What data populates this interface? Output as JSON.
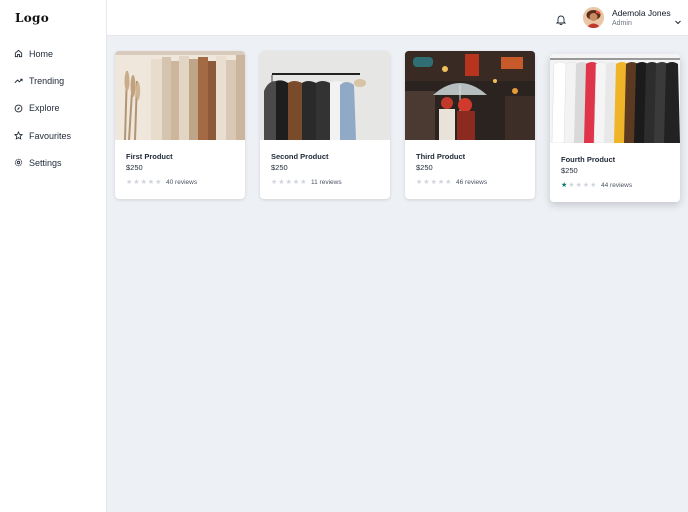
{
  "app": {
    "logo": "Logo"
  },
  "sidebar": {
    "items": [
      {
        "label": "Home",
        "icon": "home-icon"
      },
      {
        "label": "Trending",
        "icon": "trending-icon"
      },
      {
        "label": "Explore",
        "icon": "compass-icon"
      },
      {
        "label": "Favourites",
        "icon": "star-icon"
      },
      {
        "label": "Settings",
        "icon": "gear-icon"
      }
    ]
  },
  "header": {
    "user": {
      "name": "Ademola Jones",
      "role": "Admin"
    },
    "icons": [
      "bell-icon",
      "chevron-down-icon"
    ]
  },
  "products": [
    {
      "name": "First Product",
      "price": "$250",
      "rating": 0,
      "max_rating": 5,
      "reviews": "40 reviews"
    },
    {
      "name": "Second Product",
      "price": "$250",
      "rating": 0,
      "max_rating": 5,
      "reviews": "11 reviews"
    },
    {
      "name": "Third Product",
      "price": "$250",
      "rating": 0,
      "max_rating": 5,
      "reviews": "46 reviews"
    },
    {
      "name": "Fourth Product",
      "price": "$250",
      "rating": 1,
      "max_rating": 5,
      "reviews": "44 reviews"
    }
  ],
  "colors": {
    "accent": "#0f766e",
    "background": "#edf0f5",
    "star_empty": "#d1d5db"
  }
}
